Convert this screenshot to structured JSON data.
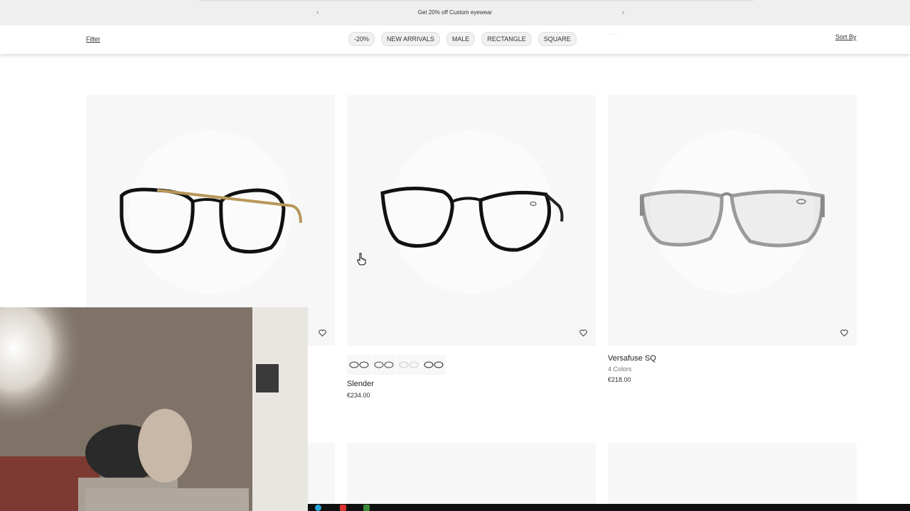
{
  "promo": {
    "message": "Get 20% off Custom eyewear",
    "prev_icon": "chevron-left-icon",
    "next_icon": "chevron-right-icon"
  },
  "filterbar": {
    "filter_label": "Filter",
    "sort_label": "Sort By",
    "chips": [
      "-20%",
      "NEW ARRIVALS",
      "MALE",
      "RECTANGLE",
      "SQUARE"
    ]
  },
  "products": [
    {
      "name": "",
      "colors": "",
      "price": "",
      "frame_color": "#111111",
      "temple_color": "#b8975a",
      "wishlist_icon": "heart-icon"
    },
    {
      "name": "Slender",
      "colors": "",
      "price": "€234.00",
      "frame_color": "#111111",
      "temple_color": "#222222",
      "wishlist_icon": "heart-icon"
    },
    {
      "name": "Versafuse SQ",
      "colors": "4 Colors",
      "price": "€218.00",
      "frame_color": "#9a9a9a",
      "temple_color": "#8a8a8a",
      "wishlist_icon": "heart-icon"
    }
  ],
  "swatch_count": 4,
  "colors": {
    "promo_bg": "#efefef",
    "card_bg": "#f7f7f7",
    "taskbar_bg": "#101010"
  }
}
